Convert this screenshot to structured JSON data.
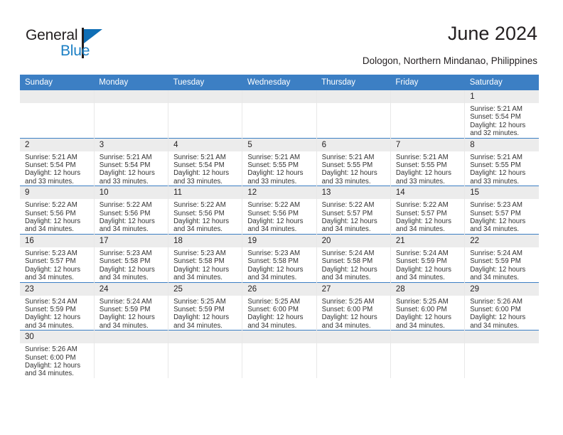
{
  "brand": {
    "name_top": "General",
    "name_bottom": "Blue",
    "color_primary": "#1b7fc4",
    "color_dark": "#231f20"
  },
  "header": {
    "title": "June 2024",
    "subtitle": "Dologon, Northern Mindanao, Philippines"
  },
  "theme": {
    "header_bg": "#3c7fc4",
    "daynum_bg": "#ececec",
    "grid_line": "#3c7fc4",
    "cell_divider": "#e8e8e8"
  },
  "weekdays": [
    "Sunday",
    "Monday",
    "Tuesday",
    "Wednesday",
    "Thursday",
    "Friday",
    "Saturday"
  ],
  "weeks": [
    [
      {
        "day": "",
        "lines": []
      },
      {
        "day": "",
        "lines": []
      },
      {
        "day": "",
        "lines": []
      },
      {
        "day": "",
        "lines": []
      },
      {
        "day": "",
        "lines": []
      },
      {
        "day": "",
        "lines": []
      },
      {
        "day": "1",
        "lines": [
          "Sunrise: 5:21 AM",
          "Sunset: 5:54 PM",
          "Daylight: 12 hours",
          "and 32 minutes."
        ]
      }
    ],
    [
      {
        "day": "2",
        "lines": [
          "Sunrise: 5:21 AM",
          "Sunset: 5:54 PM",
          "Daylight: 12 hours",
          "and 33 minutes."
        ]
      },
      {
        "day": "3",
        "lines": [
          "Sunrise: 5:21 AM",
          "Sunset: 5:54 PM",
          "Daylight: 12 hours",
          "and 33 minutes."
        ]
      },
      {
        "day": "4",
        "lines": [
          "Sunrise: 5:21 AM",
          "Sunset: 5:54 PM",
          "Daylight: 12 hours",
          "and 33 minutes."
        ]
      },
      {
        "day": "5",
        "lines": [
          "Sunrise: 5:21 AM",
          "Sunset: 5:55 PM",
          "Daylight: 12 hours",
          "and 33 minutes."
        ]
      },
      {
        "day": "6",
        "lines": [
          "Sunrise: 5:21 AM",
          "Sunset: 5:55 PM",
          "Daylight: 12 hours",
          "and 33 minutes."
        ]
      },
      {
        "day": "7",
        "lines": [
          "Sunrise: 5:21 AM",
          "Sunset: 5:55 PM",
          "Daylight: 12 hours",
          "and 33 minutes."
        ]
      },
      {
        "day": "8",
        "lines": [
          "Sunrise: 5:21 AM",
          "Sunset: 5:55 PM",
          "Daylight: 12 hours",
          "and 33 minutes."
        ]
      }
    ],
    [
      {
        "day": "9",
        "lines": [
          "Sunrise: 5:22 AM",
          "Sunset: 5:56 PM",
          "Daylight: 12 hours",
          "and 34 minutes."
        ]
      },
      {
        "day": "10",
        "lines": [
          "Sunrise: 5:22 AM",
          "Sunset: 5:56 PM",
          "Daylight: 12 hours",
          "and 34 minutes."
        ]
      },
      {
        "day": "11",
        "lines": [
          "Sunrise: 5:22 AM",
          "Sunset: 5:56 PM",
          "Daylight: 12 hours",
          "and 34 minutes."
        ]
      },
      {
        "day": "12",
        "lines": [
          "Sunrise: 5:22 AM",
          "Sunset: 5:56 PM",
          "Daylight: 12 hours",
          "and 34 minutes."
        ]
      },
      {
        "day": "13",
        "lines": [
          "Sunrise: 5:22 AM",
          "Sunset: 5:57 PM",
          "Daylight: 12 hours",
          "and 34 minutes."
        ]
      },
      {
        "day": "14",
        "lines": [
          "Sunrise: 5:22 AM",
          "Sunset: 5:57 PM",
          "Daylight: 12 hours",
          "and 34 minutes."
        ]
      },
      {
        "day": "15",
        "lines": [
          "Sunrise: 5:23 AM",
          "Sunset: 5:57 PM",
          "Daylight: 12 hours",
          "and 34 minutes."
        ]
      }
    ],
    [
      {
        "day": "16",
        "lines": [
          "Sunrise: 5:23 AM",
          "Sunset: 5:57 PM",
          "Daylight: 12 hours",
          "and 34 minutes."
        ]
      },
      {
        "day": "17",
        "lines": [
          "Sunrise: 5:23 AM",
          "Sunset: 5:58 PM",
          "Daylight: 12 hours",
          "and 34 minutes."
        ]
      },
      {
        "day": "18",
        "lines": [
          "Sunrise: 5:23 AM",
          "Sunset: 5:58 PM",
          "Daylight: 12 hours",
          "and 34 minutes."
        ]
      },
      {
        "day": "19",
        "lines": [
          "Sunrise: 5:23 AM",
          "Sunset: 5:58 PM",
          "Daylight: 12 hours",
          "and 34 minutes."
        ]
      },
      {
        "day": "20",
        "lines": [
          "Sunrise: 5:24 AM",
          "Sunset: 5:58 PM",
          "Daylight: 12 hours",
          "and 34 minutes."
        ]
      },
      {
        "day": "21",
        "lines": [
          "Sunrise: 5:24 AM",
          "Sunset: 5:59 PM",
          "Daylight: 12 hours",
          "and 34 minutes."
        ]
      },
      {
        "day": "22",
        "lines": [
          "Sunrise: 5:24 AM",
          "Sunset: 5:59 PM",
          "Daylight: 12 hours",
          "and 34 minutes."
        ]
      }
    ],
    [
      {
        "day": "23",
        "lines": [
          "Sunrise: 5:24 AM",
          "Sunset: 5:59 PM",
          "Daylight: 12 hours",
          "and 34 minutes."
        ]
      },
      {
        "day": "24",
        "lines": [
          "Sunrise: 5:24 AM",
          "Sunset: 5:59 PM",
          "Daylight: 12 hours",
          "and 34 minutes."
        ]
      },
      {
        "day": "25",
        "lines": [
          "Sunrise: 5:25 AM",
          "Sunset: 5:59 PM",
          "Daylight: 12 hours",
          "and 34 minutes."
        ]
      },
      {
        "day": "26",
        "lines": [
          "Sunrise: 5:25 AM",
          "Sunset: 6:00 PM",
          "Daylight: 12 hours",
          "and 34 minutes."
        ]
      },
      {
        "day": "27",
        "lines": [
          "Sunrise: 5:25 AM",
          "Sunset: 6:00 PM",
          "Daylight: 12 hours",
          "and 34 minutes."
        ]
      },
      {
        "day": "28",
        "lines": [
          "Sunrise: 5:25 AM",
          "Sunset: 6:00 PM",
          "Daylight: 12 hours",
          "and 34 minutes."
        ]
      },
      {
        "day": "29",
        "lines": [
          "Sunrise: 5:26 AM",
          "Sunset: 6:00 PM",
          "Daylight: 12 hours",
          "and 34 minutes."
        ]
      }
    ],
    [
      {
        "day": "30",
        "lines": [
          "Sunrise: 5:26 AM",
          "Sunset: 6:00 PM",
          "Daylight: 12 hours",
          "and 34 minutes."
        ]
      },
      {
        "day": "",
        "lines": []
      },
      {
        "day": "",
        "lines": []
      },
      {
        "day": "",
        "lines": []
      },
      {
        "day": "",
        "lines": []
      },
      {
        "day": "",
        "lines": []
      },
      {
        "day": "",
        "lines": []
      }
    ]
  ]
}
